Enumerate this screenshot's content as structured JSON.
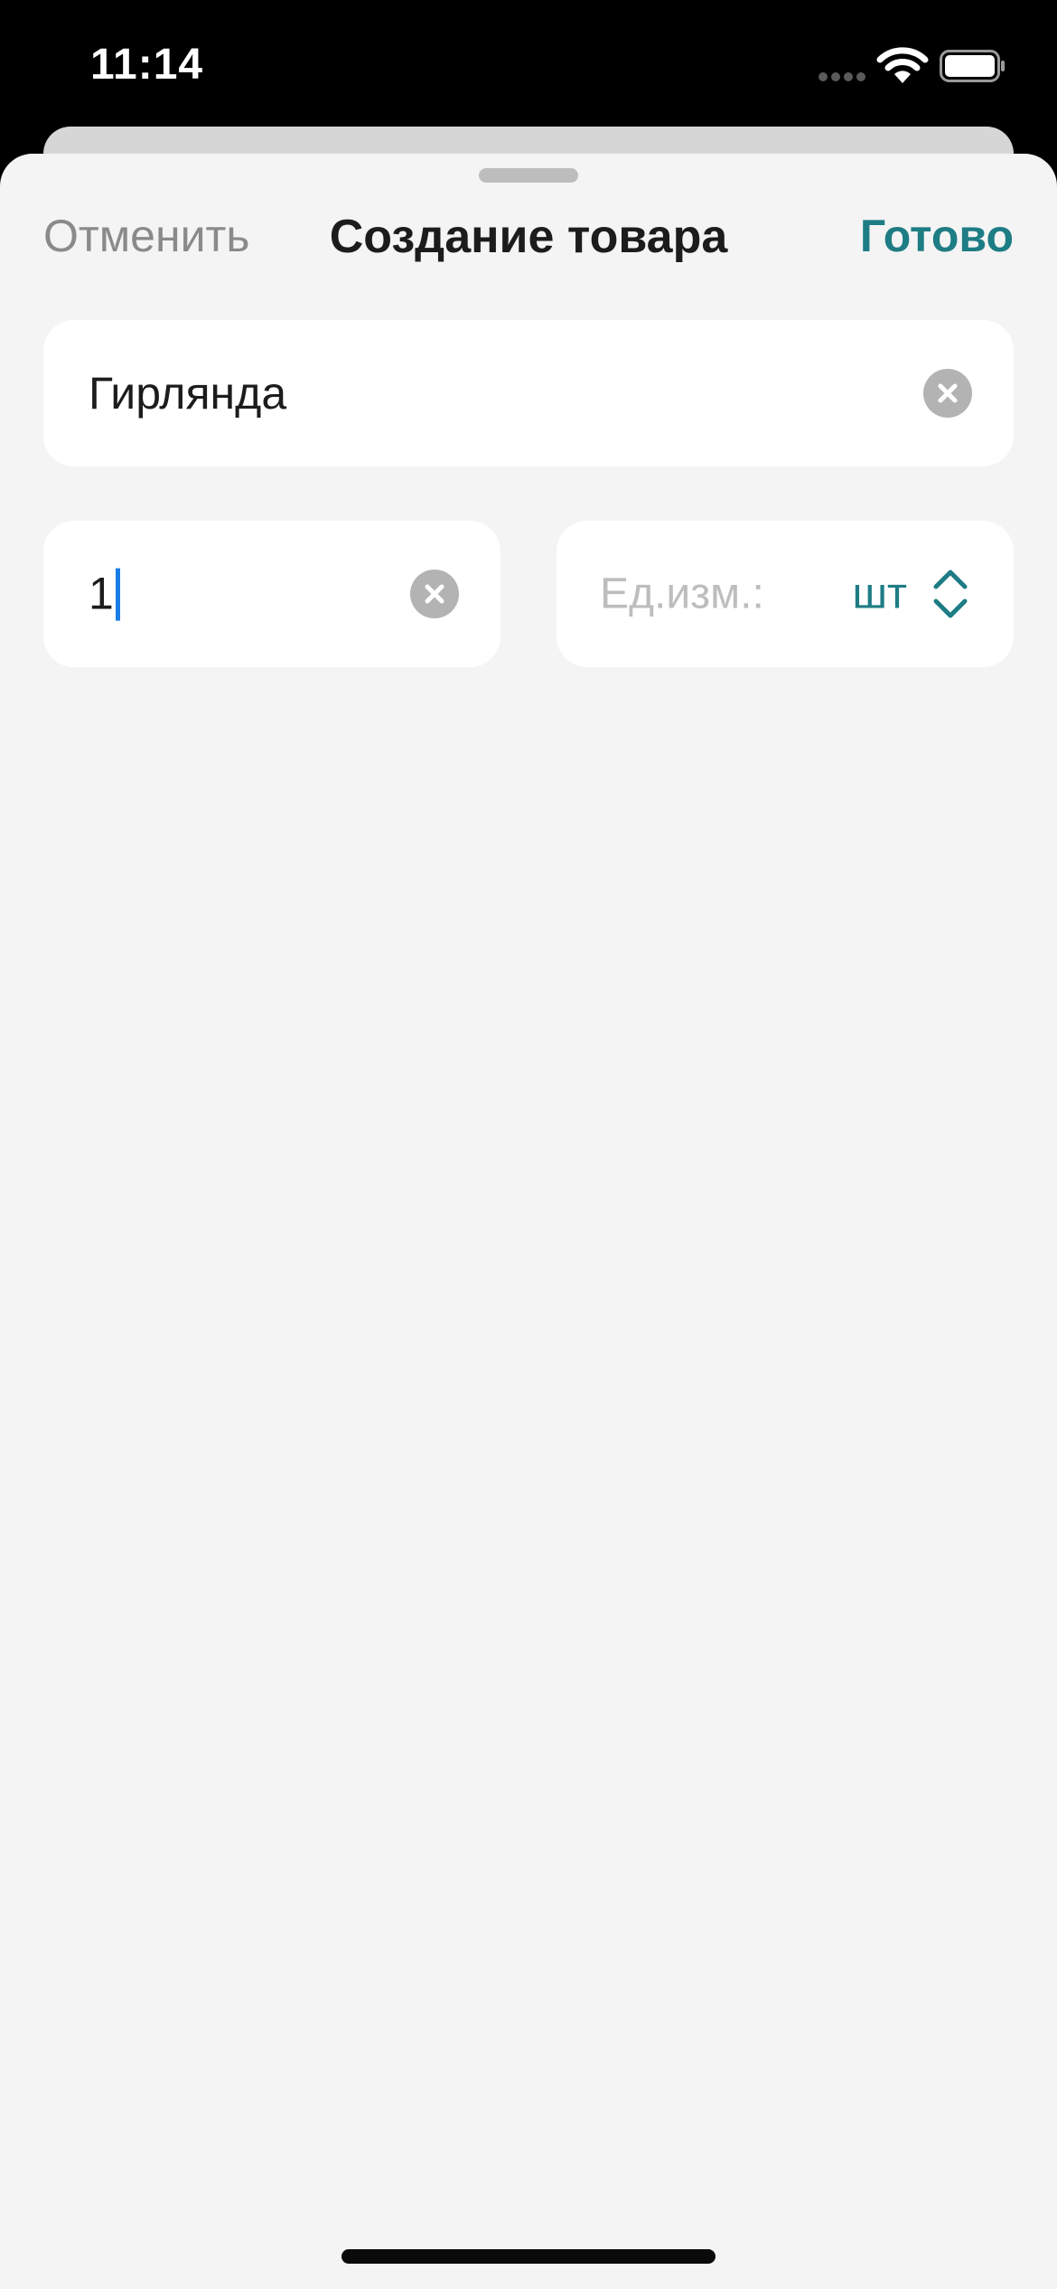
{
  "status_bar": {
    "time": "11:14",
    "icons": [
      "cellular-dots-icon",
      "wifi-icon",
      "battery-icon"
    ]
  },
  "nav": {
    "cancel_label": "Отменить",
    "title": "Создание товара",
    "done_label": "Готово"
  },
  "form": {
    "name_value": "Гирлянда",
    "quantity_value": "1",
    "unit_label": "Ед.изм.:",
    "unit_value": "шт"
  },
  "colors": {
    "accent": "#1e7c84",
    "sheet_background": "#f4f4f4",
    "field_background": "#ffffff",
    "placeholder": "#bdbdbd",
    "caret": "#1a7de6"
  }
}
